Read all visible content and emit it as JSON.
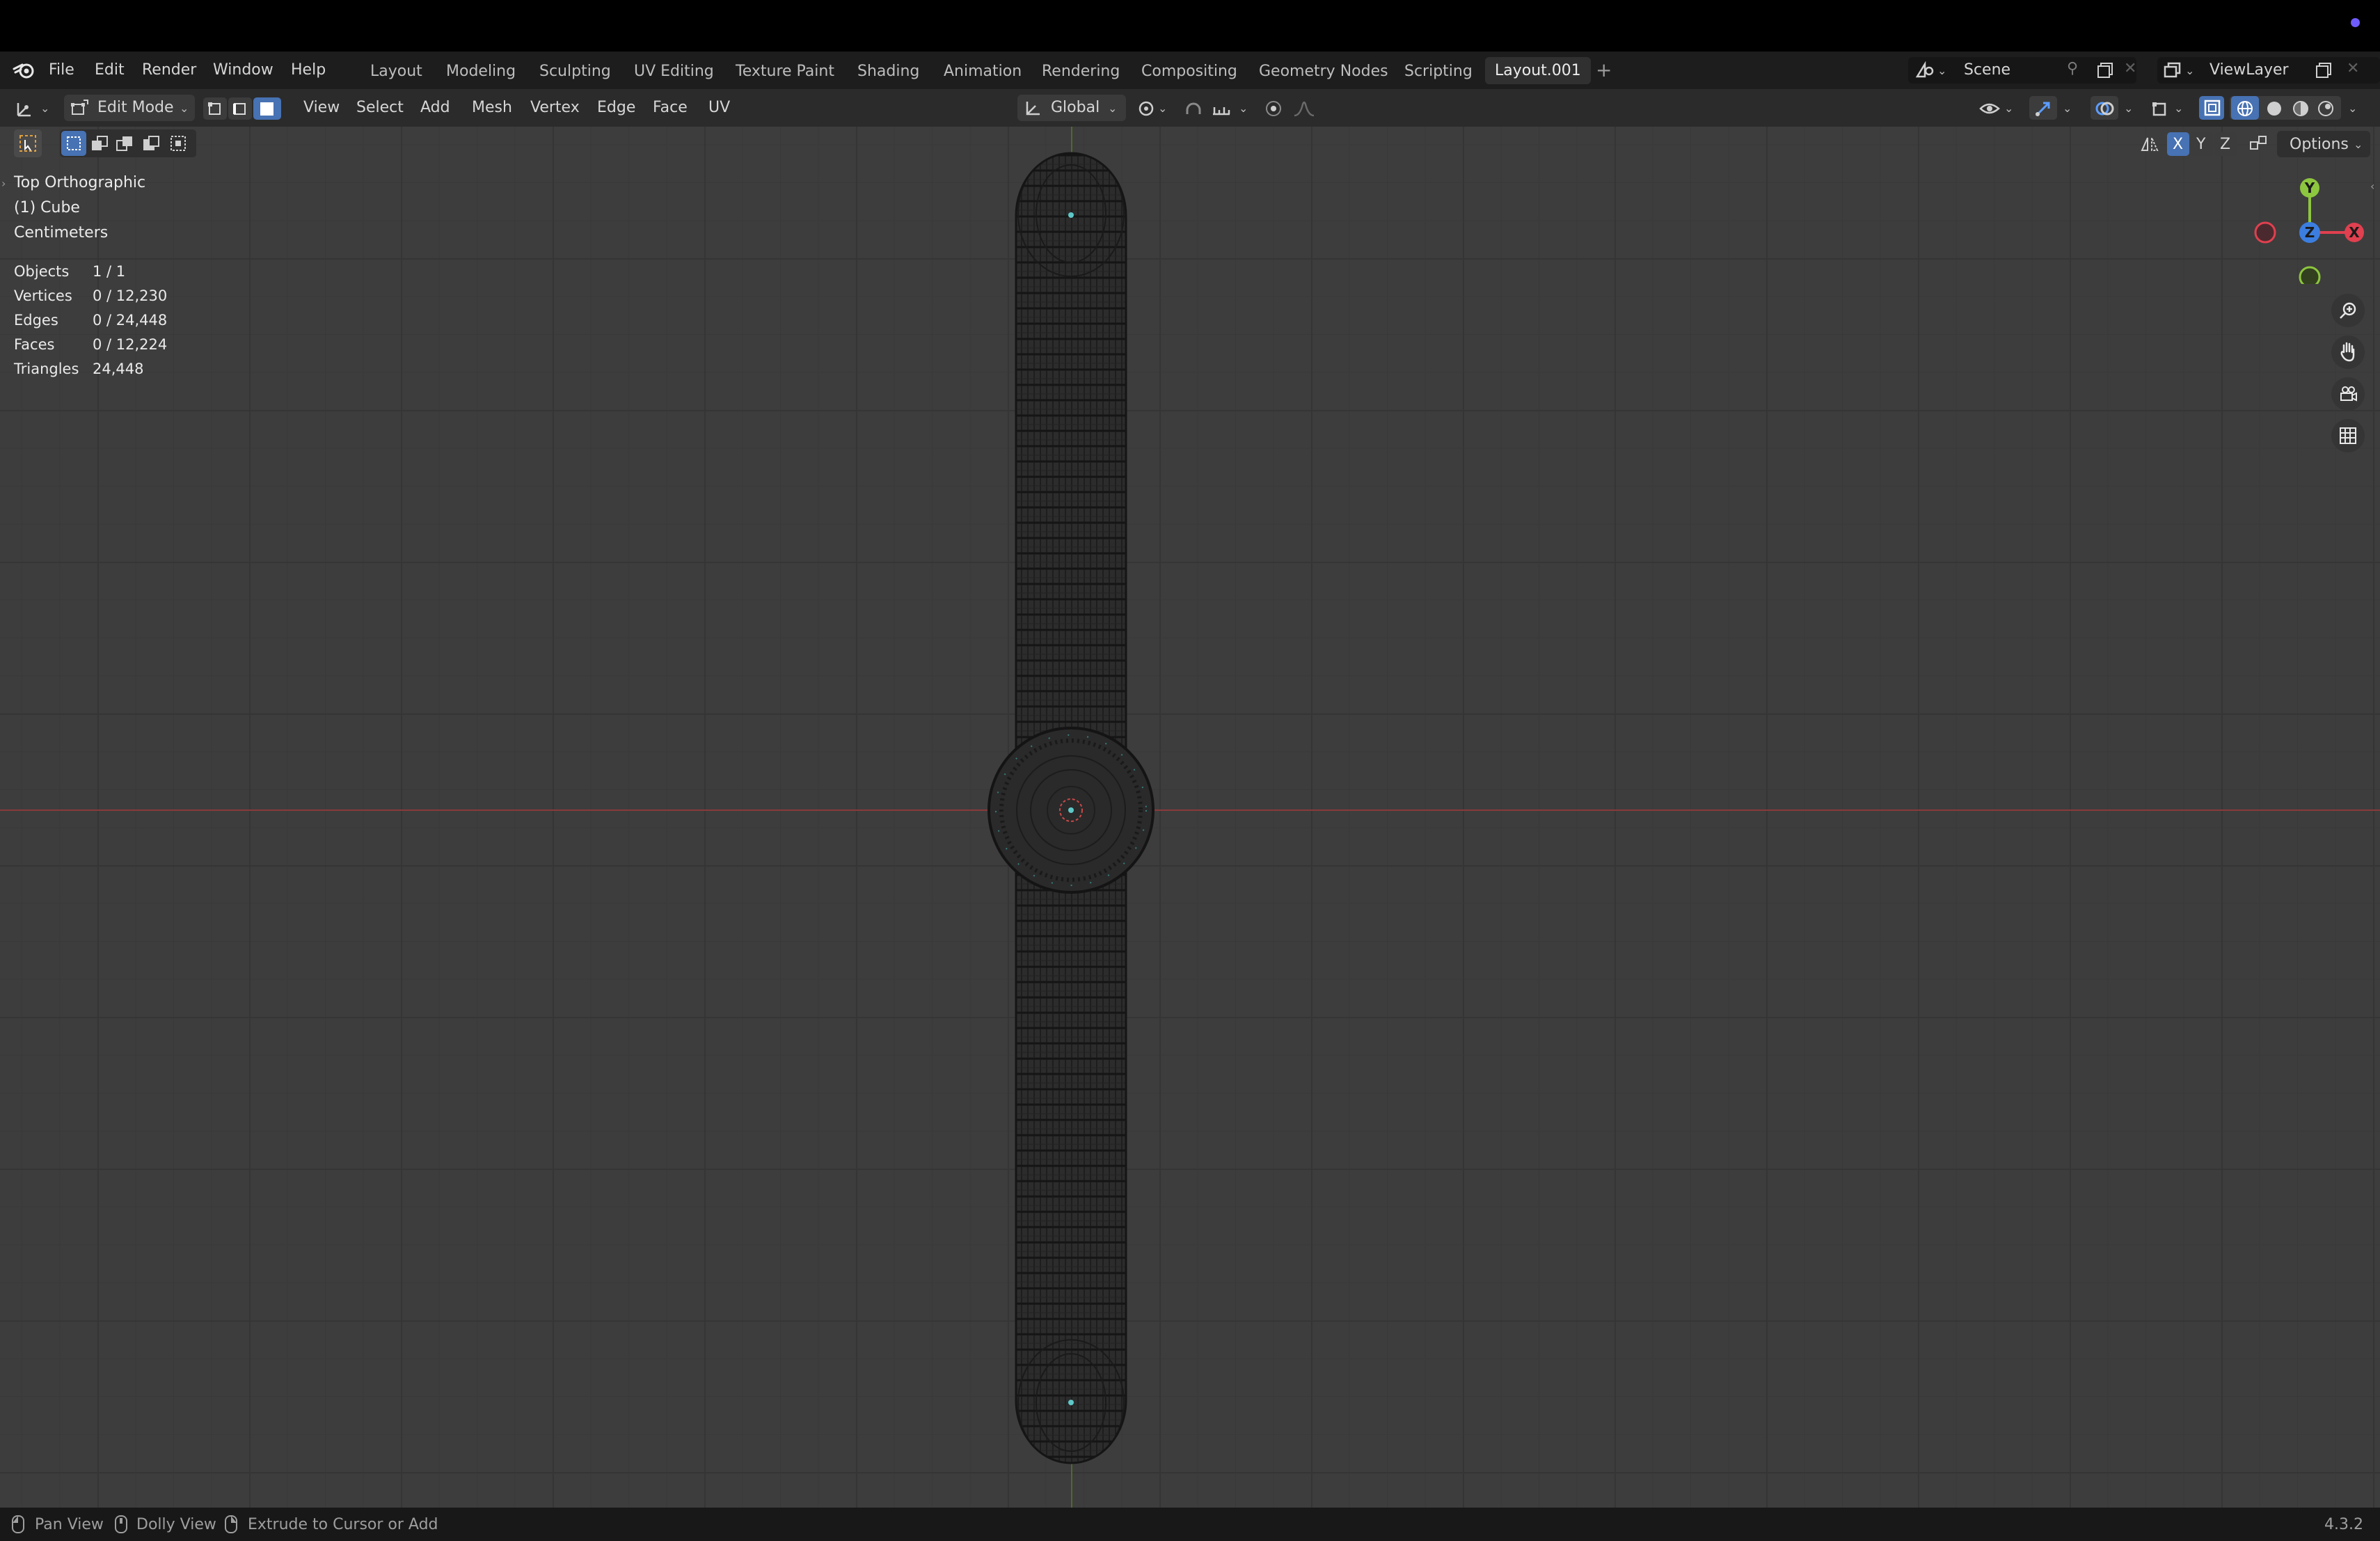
{
  "app": {
    "version": "4.3.2"
  },
  "menu": {
    "file": "File",
    "edit": "Edit",
    "render": "Render",
    "window": "Window",
    "help": "Help"
  },
  "workspaces": {
    "layout": "Layout",
    "modeling": "Modeling",
    "sculpting": "Sculpting",
    "uv_editing": "UV Editing",
    "texture_paint": "Texture Paint",
    "shading": "Shading",
    "animation": "Animation",
    "rendering": "Rendering",
    "compositing": "Compositing",
    "geometry_nodes": "Geometry Nodes",
    "scripting": "Scripting",
    "active": "Layout.001"
  },
  "scene": {
    "name": "Scene"
  },
  "view_layer": {
    "name": "ViewLayer"
  },
  "header": {
    "mode": "Edit Mode",
    "view": "View",
    "select": "Select",
    "add": "Add",
    "mesh": "Mesh",
    "vertex": "Vertex",
    "edge": "Edge",
    "face": "Face",
    "uv": "UV",
    "transform_orientation": "Global",
    "options": "Options",
    "axis_x": "X",
    "axis_y": "Y",
    "axis_z": "Z",
    "select_mode_active": "face"
  },
  "overlay": {
    "view_name": "Top Orthographic",
    "object": "(1) Cube",
    "units": "Centimeters",
    "stats": [
      {
        "label": "Objects",
        "value": "1 / 1"
      },
      {
        "label": "Vertices",
        "value": "0 / 12,230"
      },
      {
        "label": "Edges",
        "value": "0 / 24,448"
      },
      {
        "label": "Faces",
        "value": "0 / 12,224"
      },
      {
        "label": "Triangles",
        "value": "24,448"
      }
    ]
  },
  "gizmo": {
    "y": "Y",
    "z": "Z",
    "x": "X"
  },
  "status": {
    "pan": "Pan View",
    "dolly": "Dolly View",
    "extrude": "Extrude to Cursor or Add"
  },
  "colors": {
    "accent": "#4772b3",
    "x_axis": "#e0404f",
    "y_axis": "#8dc63f",
    "z_axis": "#3c7ee0",
    "grid_bg": "#3d3d3d"
  }
}
